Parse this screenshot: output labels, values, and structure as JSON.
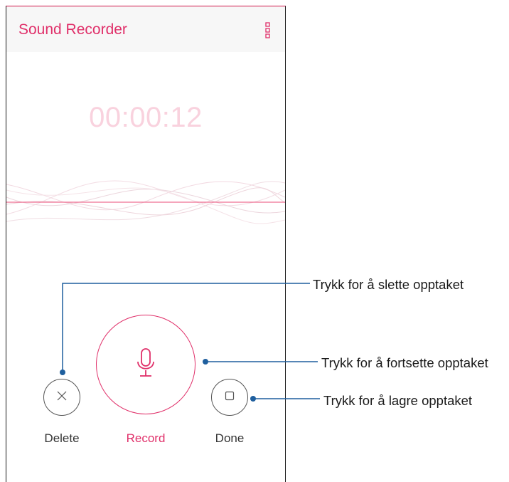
{
  "app": {
    "title": "Sound Recorder",
    "menu_icon": "more-vert-icon"
  },
  "recording": {
    "elapsed_time": "00:00:12"
  },
  "controls": {
    "delete_label": "Delete",
    "record_label": "Record",
    "done_label": "Done",
    "delete_icon": "close-icon",
    "record_icon": "microphone-icon",
    "done_icon": "stop-icon"
  },
  "callouts": {
    "delete": "Trykk for å slette opptaket",
    "record": "Trykk for å fortsette opptaket",
    "done": "Trykk for å lagre opptaket"
  },
  "colors": {
    "accent": "#e0306a",
    "timer": "#f9d2de",
    "callout_line": "#1f5f9e"
  }
}
